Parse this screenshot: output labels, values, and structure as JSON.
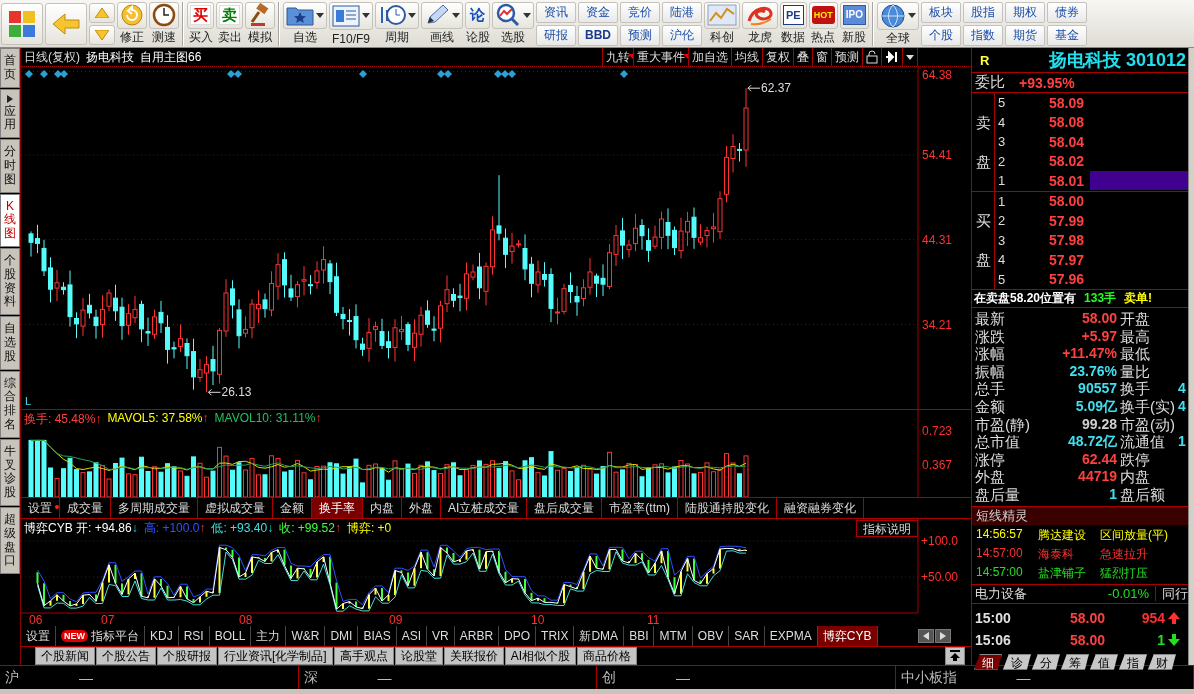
{
  "toolbar": {
    "items": [
      {
        "kind": "tile"
      },
      {
        "kind": "tile"
      },
      {
        "kind": "stack"
      },
      {
        "kind": "tool",
        "label": "修正",
        "dropdown": false
      },
      {
        "kind": "tool",
        "label": "测速",
        "dropdown": false
      },
      {
        "kind": "separator"
      },
      {
        "kind": "tool",
        "label": "买入",
        "glyph": "买",
        "dropdown": false
      },
      {
        "kind": "tool",
        "label": "卖出",
        "glyph": "卖",
        "dropdown": false
      },
      {
        "kind": "tool",
        "label": "模拟",
        "dropdown": false
      },
      {
        "kind": "separator"
      },
      {
        "kind": "tool",
        "label": "自选",
        "dropdown": true
      },
      {
        "kind": "tool",
        "label": "F10/F9",
        "dropdown": true
      },
      {
        "kind": "tool",
        "label": "周期",
        "dropdown": true
      },
      {
        "kind": "tool",
        "label": "画线",
        "dropdown": true
      },
      {
        "kind": "tool",
        "label": "论股",
        "glyph": "论",
        "dropdown": false
      },
      {
        "kind": "tool",
        "label": "选股",
        "dropdown": true
      },
      {
        "kind": "pair",
        "top": "资讯",
        "bottom": "研报",
        "bottom_bold": false
      },
      {
        "kind": "pair",
        "top": "资金",
        "bottom": "BBD",
        "bottom_bold": true
      },
      {
        "kind": "pair",
        "top": "竞价",
        "bottom": "预测",
        "bottom_bold": false
      },
      {
        "kind": "pair",
        "top": "陆港",
        "bottom": "沪伦",
        "bottom_bold": false
      },
      {
        "kind": "tool",
        "label": "科创",
        "dropdown": false
      },
      {
        "kind": "tool",
        "label": "龙虎",
        "dropdown": false
      },
      {
        "kind": "tool",
        "label": "数据",
        "glyph": "PE",
        "dropdown": false
      },
      {
        "kind": "tool",
        "label": "热点",
        "glyph": "HOT",
        "dropdown": false
      },
      {
        "kind": "tool",
        "label": "新股",
        "glyph": "IPO",
        "dropdown": false
      },
      {
        "kind": "separator"
      },
      {
        "kind": "tool",
        "label": "全球",
        "dropdown": true
      },
      {
        "kind": "pair",
        "top": "板块",
        "bottom": "个股",
        "bottom_bold": false
      },
      {
        "kind": "pair",
        "top": "股指",
        "bottom": "指数",
        "bottom_bold": false
      },
      {
        "kind": "pair",
        "top": "期权",
        "bottom": "期货",
        "bottom_bold": false
      },
      {
        "kind": "pair",
        "top": "债券",
        "bottom": "基金",
        "bottom_bold": false
      }
    ]
  },
  "side_tabs": [
    {
      "label": "首页",
      "selected": false,
      "submenu": false
    },
    {
      "label": "应用",
      "selected": false,
      "submenu": true
    },
    {
      "label": "分时图",
      "selected": false,
      "submenu": false
    },
    {
      "label": "K线图",
      "selected": true,
      "submenu": false
    },
    {
      "label": "个股资料",
      "selected": false,
      "submenu": false
    },
    {
      "label": "自选股",
      "selected": false,
      "submenu": false
    },
    {
      "label": "综合排名",
      "selected": false,
      "submenu": false
    },
    {
      "label": "牛叉诊股",
      "selected": false,
      "submenu": false
    },
    {
      "label": "超级盘口",
      "selected": false,
      "submenu": false
    }
  ],
  "chart_header": {
    "period": "日线(复权)",
    "stock": "扬电科技",
    "template": "自用主图66",
    "buttons": [
      {
        "label": "九转",
        "flagged": true
      },
      {
        "label": "重大事件",
        "flagged": true
      },
      {
        "label": "加自选",
        "flagged": false
      },
      {
        "label": "均线",
        "flagged": false
      },
      {
        "label": "复权",
        "flagged": false
      },
      {
        "label": "叠",
        "flagged": false
      },
      {
        "label": "窗",
        "flagged": false
      },
      {
        "label": "预测",
        "flagged": false
      }
    ]
  },
  "price_chart": {
    "axis_labels": [
      "64.38",
      "54.41",
      "44.31",
      "34.21"
    ],
    "high_note": "62.37",
    "low_note": "26.13",
    "corner_mark": "L"
  },
  "turnover": {
    "legend": [
      {
        "label": "换手: 45.48%",
        "color": "#ff4040",
        "arrow": "↑",
        "rising": true
      },
      {
        "label": "MAVOL5: 37.58%",
        "color": "#ffff00",
        "arrow": "↑",
        "rising": true
      },
      {
        "label": "MAVOL10: 31.11%",
        "color": "#20c060",
        "arrow": "↑",
        "rising": true
      }
    ],
    "axis_labels": [
      "0.723",
      "0.367"
    ],
    "tabs": [
      {
        "label": "设置",
        "selected": false,
        "flagged": true
      },
      {
        "label": "成交量",
        "selected": false,
        "flagged": false
      },
      {
        "label": "多周期成交量",
        "selected": false,
        "flagged": false
      },
      {
        "label": "虚拟成交量",
        "selected": false,
        "flagged": false
      },
      {
        "label": "金额",
        "selected": false,
        "flagged": false
      },
      {
        "label": "换手率",
        "selected": true,
        "flagged": false
      },
      {
        "label": "内盘",
        "selected": false,
        "flagged": false
      },
      {
        "label": "外盘",
        "selected": false,
        "flagged": false
      },
      {
        "label": "AI立桩成交量",
        "selected": false,
        "flagged": false
      },
      {
        "label": "盘后成交量",
        "selected": false,
        "flagged": false
      },
      {
        "label": "市盈率(ttm)",
        "selected": false,
        "flagged": false
      },
      {
        "label": "陆股通持股变化",
        "selected": false,
        "flagged": false
      },
      {
        "label": "融资融券变化",
        "selected": false,
        "flagged": false
      }
    ]
  },
  "cyb": {
    "legend": [
      {
        "label": "博弈CYB 开: +94.86",
        "color": "#ffffff",
        "arrow": "↓",
        "rising": false
      },
      {
        "label": "高: +100.0",
        "color": "#3050ff",
        "arrow": "↑",
        "rising": true
      },
      {
        "label": "低: +93.40",
        "color": "#40e0e0",
        "arrow": "↓",
        "rising": false
      },
      {
        "label": "收: +99.52",
        "color": "#40ff40",
        "arrow": "↑",
        "rising": true
      },
      {
        "label": "博弈: +0",
        "color": "#ffff00"
      }
    ],
    "explain_button": "指标说明",
    "axis_labels": [
      "+100.0",
      "+50.00"
    ],
    "months": [
      "06",
      "07",
      "08",
      "09",
      "10",
      "11"
    ]
  },
  "indicator_tabs": [
    {
      "label": "设置",
      "selected": false
    },
    {
      "label": "指标平台",
      "selected": false,
      "badge": "NEW"
    },
    {
      "label": "KDJ",
      "selected": false
    },
    {
      "label": "RSI",
      "selected": false
    },
    {
      "label": "BOLL",
      "selected": false
    },
    {
      "label": "主力",
      "selected": false
    },
    {
      "label": "W&R",
      "selected": false
    },
    {
      "label": "DMI",
      "selected": false
    },
    {
      "label": "BIAS",
      "selected": false
    },
    {
      "label": "ASI",
      "selected": false
    },
    {
      "label": "VR",
      "selected": false
    },
    {
      "label": "ARBR",
      "selected": false
    },
    {
      "label": "DPO",
      "selected": false
    },
    {
      "label": "TRIX",
      "selected": false
    },
    {
      "label": "新DMA",
      "selected": false
    },
    {
      "label": "BBI",
      "selected": false
    },
    {
      "label": "MTM",
      "selected": false
    },
    {
      "label": "OBV",
      "selected": false
    },
    {
      "label": "SAR",
      "selected": false
    },
    {
      "label": "EXPMA",
      "selected": false
    },
    {
      "label": "博弈CYB",
      "selected": true
    }
  ],
  "news_tabs": [
    "个股新闻",
    "个股公告",
    "个股研报",
    "行业资讯[化学制品]",
    "高手观点",
    "论股堂",
    "关联报价",
    "AI相似个股",
    "商品价格"
  ],
  "quote": {
    "flag": "R",
    "title": "扬电科技 301012",
    "ratio_label": "委比",
    "ratio": "+93.95%",
    "sell_label": "卖盘",
    "buy_label": "买盘",
    "sell": [
      {
        "rank": "5",
        "price": "58.09",
        "highlighted": false
      },
      {
        "rank": "4",
        "price": "58.08",
        "highlighted": false
      },
      {
        "rank": "3",
        "price": "58.04",
        "highlighted": false
      },
      {
        "rank": "2",
        "price": "58.02",
        "highlighted": false
      },
      {
        "rank": "1",
        "price": "58.01",
        "highlighted": true
      }
    ],
    "buy": [
      {
        "rank": "1",
        "price": "58.00",
        "highlighted": false
      },
      {
        "rank": "2",
        "price": "57.99",
        "highlighted": false
      },
      {
        "rank": "3",
        "price": "57.98",
        "highlighted": false
      },
      {
        "rank": "4",
        "price": "57.97",
        "highlighted": false
      },
      {
        "rank": "5",
        "price": "57.96",
        "highlighted": false
      }
    ],
    "notice": [
      {
        "text": "在卖盘58.20位置有",
        "color": "#ffffff"
      },
      {
        "text": "133手",
        "color": "#20ff20"
      },
      {
        "text": "卖单!",
        "color": "#ffff00"
      }
    ],
    "stats": [
      {
        "label": "最新",
        "value": "58.00",
        "color": "#ff4040",
        "right_label": "开盘"
      },
      {
        "label": "涨跌",
        "value": "+5.97",
        "color": "#ff4040",
        "right_label": "最高"
      },
      {
        "label": "涨幅",
        "value": "+11.47%",
        "color": "#ff4040",
        "right_label": "最低"
      },
      {
        "label": "振幅",
        "value": "23.76%",
        "color": "#40e0f0",
        "right_label": "量比"
      },
      {
        "label": "总手",
        "value": "90557",
        "color": "#40e0f0",
        "right_label": "换手",
        "right_value": "4"
      },
      {
        "label": "金额",
        "value": "5.09亿",
        "color": "#40e0f0",
        "right_label": "换手(实)",
        "right_value": "4"
      },
      {
        "label": "市盈(静)",
        "value": "99.28",
        "color": "#d0d0d0",
        "right_label": "市盈(动)"
      },
      {
        "label": "总市值",
        "value": "48.72亿",
        "color": "#40e0f0",
        "right_label": "流通值",
        "right_value": "1"
      },
      {
        "label": "涨停",
        "value": "62.44",
        "color": "#ff4040",
        "right_label": "跌停"
      },
      {
        "label": "外盘",
        "value": "44719",
        "color": "#ff4040",
        "right_label": "内盘"
      },
      {
        "label": "盘后量",
        "value": "1",
        "color": "#40e0f0",
        "right_label": "盘后额"
      }
    ],
    "alerts_title": "短线精灵",
    "alerts": [
      {
        "time": "14:56:57",
        "stock": "腾达建设",
        "event": "区间放量(平)",
        "color": "#ffff00"
      },
      {
        "time": "14:57:00",
        "stock": "海泰科",
        "event": "急速拉升",
        "color": "#ff3030"
      },
      {
        "time": "14:57:00",
        "stock": "盐津铺子",
        "event": "猛烈打压",
        "color": "#20e020"
      }
    ],
    "industry": {
      "name": "电力设备",
      "change": "-0.01%",
      "peer": "同行"
    },
    "ticks": [
      {
        "time": "15:00",
        "price": "58.00",
        "volume": "954",
        "rising": true
      },
      {
        "time": "15:06",
        "price": "58.00",
        "volume": "1",
        "rising": false
      }
    ],
    "tabs": [
      {
        "label": "细",
        "selected": true
      },
      {
        "label": "诊",
        "selected": false
      },
      {
        "label": "分",
        "selected": false
      },
      {
        "label": "筹",
        "selected": false
      },
      {
        "label": "值",
        "selected": false
      },
      {
        "label": "指",
        "selected": false
      },
      {
        "label": "财",
        "selected": false
      }
    ]
  },
  "status_bar": [
    {
      "market": "沪",
      "value": "—"
    },
    {
      "market": "深",
      "value": "—"
    },
    {
      "market": "创",
      "value": "—"
    },
    {
      "market": "中小板指",
      "value": "—"
    }
  ]
}
